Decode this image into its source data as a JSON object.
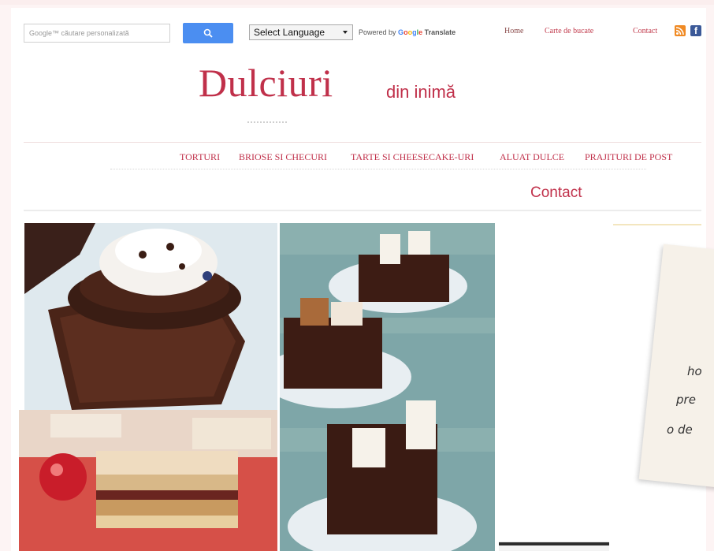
{
  "search": {
    "placeholder": "Google™ căutare personalizată"
  },
  "translate": {
    "select_label": "Select Language",
    "powered_text": "Powered by",
    "translate_text": "Translate"
  },
  "toplinks": {
    "home": "Home",
    "carte": "Carte de bucate",
    "contact": "Contact"
  },
  "header": {
    "title": "Dulciuri",
    "tagline": "din inimă"
  },
  "nav": {
    "items": [
      "TORTURI",
      "BRIOSE SI CHECURI",
      "TARTE SI CHEESECAKE-URI",
      "ALUAT DULCE",
      "PRAJITURI DE POST"
    ],
    "contact": "Contact"
  },
  "note": {
    "lines": [
      "ho",
      "pre",
      "o de"
    ]
  },
  "colors": {
    "brand": "#c0304a",
    "search_button": "#4b8ef1",
    "rss": "#f08a24",
    "facebook": "#3b5998"
  }
}
